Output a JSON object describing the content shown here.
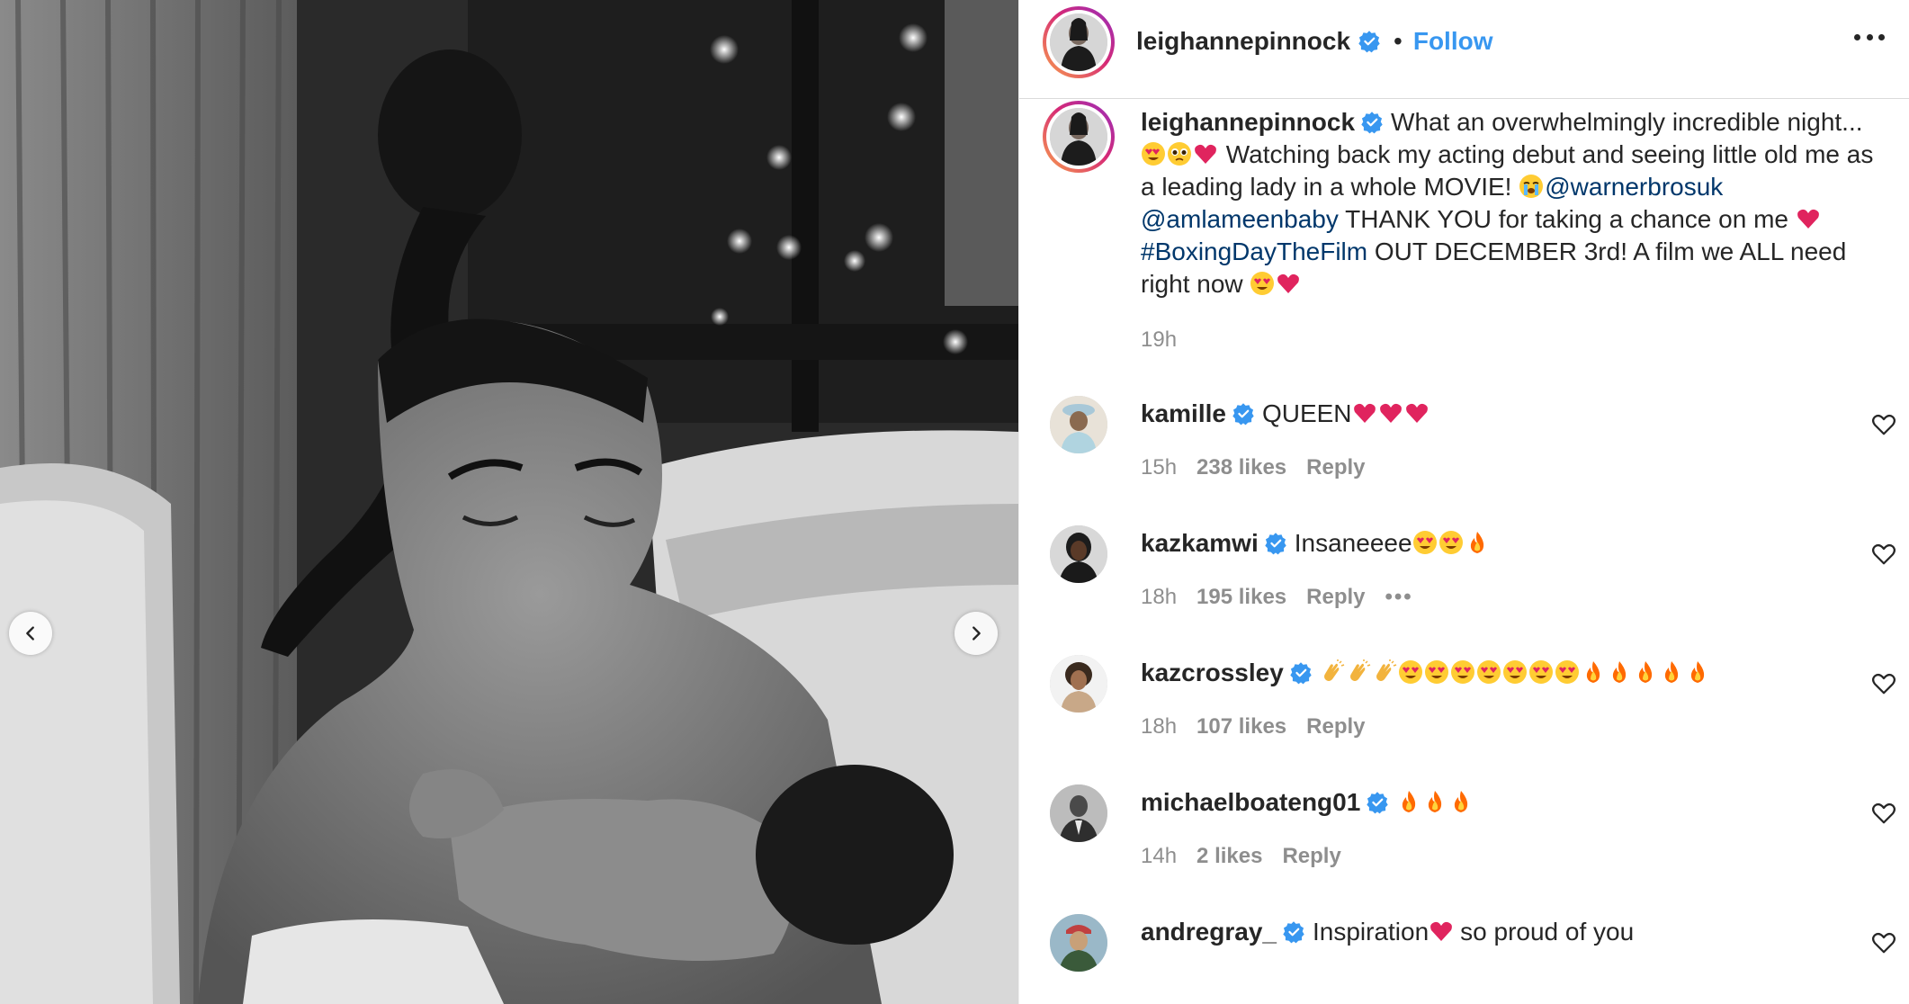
{
  "post": {
    "author": "leighannepinnock",
    "follow_label": "Follow",
    "separator": "•",
    "caption": {
      "username": "leighannepinnock",
      "text_1": "What an overwhelmingly incredible night...",
      "text_2": "Watching back my acting debut and seeing little old me as a leading lady in a whole MOVIE!",
      "mention_1": "@warnerbrosuk",
      "mention_2": "@amlameenbaby",
      "text_3": "THANK YOU for taking a chance on me",
      "hashtag": "#BoxingDayTheFilm",
      "text_4": "OUT DECEMBER 3rd! A film we ALL need right now",
      "time": "19h"
    },
    "comments": [
      {
        "username": "kamille",
        "text": "QUEEN",
        "emoji": [
          "heart",
          "heart",
          "heart"
        ],
        "time": "15h",
        "likes": "238 likes",
        "reply": "Reply"
      },
      {
        "username": "kazkamwi",
        "text": "Insaneeee",
        "emoji": [
          "heart-eyes",
          "heart-eyes",
          "fire"
        ],
        "time": "18h",
        "likes": "195 likes",
        "reply": "Reply",
        "more": "•••"
      },
      {
        "username": "kazcrossley",
        "text": "",
        "emoji": [
          "clap",
          "clap",
          "clap",
          "heart-eyes",
          "heart-eyes",
          "heart-eyes",
          "heart-eyes",
          "heart-eyes",
          "heart-eyes",
          "heart-eyes",
          "fire",
          "fire",
          "fire",
          "fire",
          "fire"
        ],
        "time": "18h",
        "likes": "107 likes",
        "reply": "Reply"
      },
      {
        "username": "michaelboateng01",
        "text": "",
        "emoji": [
          "fire",
          "fire",
          "fire"
        ],
        "time": "14h",
        "likes": "2 likes",
        "reply": "Reply"
      },
      {
        "username": "andregray_",
        "text_1": "Inspiration",
        "text_2": "so proud of you",
        "emoji": [
          "heart"
        ]
      }
    ]
  },
  "icons": {
    "prev": "chevron-left-icon",
    "next": "chevron-right-icon",
    "verified": "verified-badge-icon",
    "like": "heart-outline-icon",
    "more": "more-horizontal-icon"
  },
  "colors": {
    "link": "#00376b",
    "follow": "#3897f0",
    "muted": "#8e8e8e",
    "verified": "#3897f0"
  }
}
